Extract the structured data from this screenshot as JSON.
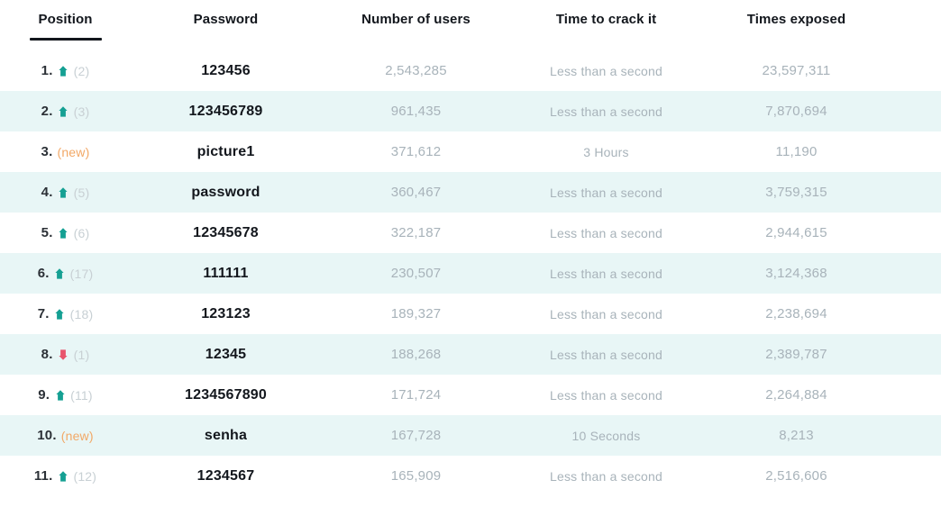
{
  "table": {
    "columns": [
      {
        "label": "Position",
        "key": "position",
        "active": true
      },
      {
        "label": "Password",
        "key": "password",
        "active": false
      },
      {
        "label": "Number of users",
        "key": "users",
        "active": false
      },
      {
        "label": "Time to crack it",
        "key": "crack",
        "active": false
      },
      {
        "label": "Times exposed",
        "key": "exposed",
        "active": false
      }
    ],
    "new_badge_label": "(new)",
    "rows": [
      {
        "rank": "1.",
        "trend": "up",
        "prev": "(2)",
        "password": "123456",
        "users": "2,543,285",
        "crack": "Less than a second",
        "exposed": "23,597,311"
      },
      {
        "rank": "2.",
        "trend": "up",
        "prev": "(3)",
        "password": "123456789",
        "users": "961,435",
        "crack": "Less than a second",
        "exposed": "7,870,694"
      },
      {
        "rank": "3.",
        "trend": "new",
        "prev": "(new)",
        "password": "picture1",
        "users": "371,612",
        "crack": "3 Hours",
        "exposed": "11,190"
      },
      {
        "rank": "4.",
        "trend": "up",
        "prev": "(5)",
        "password": "password",
        "users": "360,467",
        "crack": "Less than a second",
        "exposed": "3,759,315"
      },
      {
        "rank": "5.",
        "trend": "up",
        "prev": "(6)",
        "password": "12345678",
        "users": "322,187",
        "crack": "Less than a second",
        "exposed": "2,944,615"
      },
      {
        "rank": "6.",
        "trend": "up",
        "prev": "(17)",
        "password": "111111",
        "users": "230,507",
        "crack": "Less than a second",
        "exposed": "3,124,368"
      },
      {
        "rank": "7.",
        "trend": "up",
        "prev": "(18)",
        "password": "123123",
        "users": "189,327",
        "crack": "Less than a second",
        "exposed": "2,238,694"
      },
      {
        "rank": "8.",
        "trend": "down",
        "prev": "(1)",
        "password": "12345",
        "users": "188,268",
        "crack": "Less than a second",
        "exposed": "2,389,787"
      },
      {
        "rank": "9.",
        "trend": "up",
        "prev": "(11)",
        "password": "1234567890",
        "users": "171,724",
        "crack": "Less than a second",
        "exposed": "2,264,884"
      },
      {
        "rank": "10.",
        "trend": "new",
        "prev": "(new)",
        "password": "senha",
        "users": "167,728",
        "crack": "10 Seconds",
        "exposed": "8,213"
      },
      {
        "rank": "11.",
        "trend": "up",
        "prev": "(12)",
        "password": "1234567",
        "users": "165,909",
        "crack": "Less than a second",
        "exposed": "2,516,606"
      }
    ]
  },
  "colors": {
    "row_alt_background": "#e8f6f6",
    "row_background": "#ffffff",
    "trend_up": "#15a093",
    "trend_down": "#e8556d",
    "new_badge": "#f2a866",
    "muted_text": "#a8b3ba",
    "prev_text": "#c8d0d4",
    "heading_text": "#12161c",
    "active_column_underline": "#12161c"
  }
}
